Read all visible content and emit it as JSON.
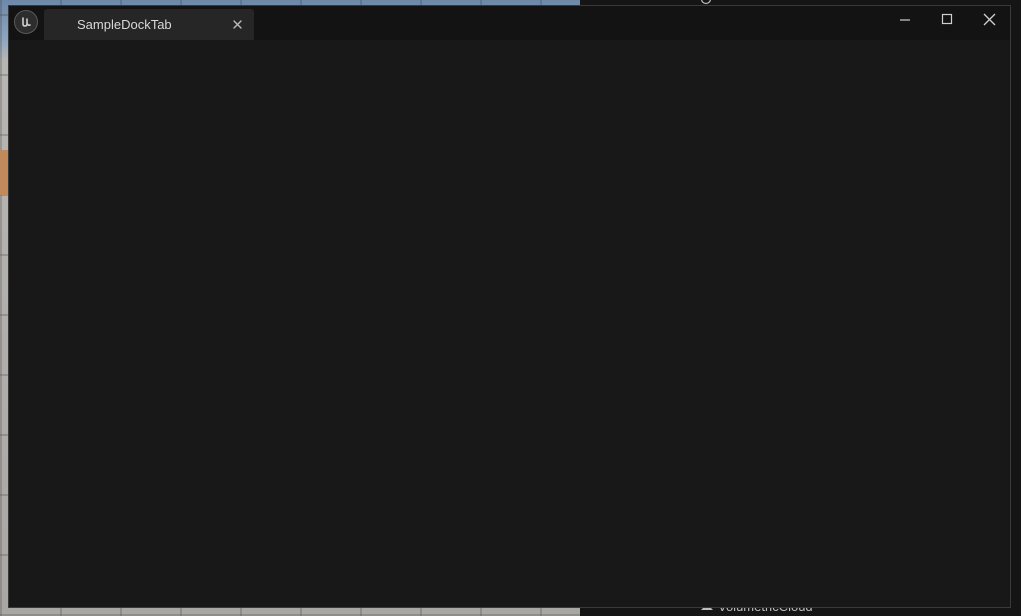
{
  "window": {
    "tab_label": "SampleDockTab"
  },
  "icons": {
    "app_logo": "unreal-engine-logo-icon",
    "tab_close": "close-icon",
    "minimize": "minimize-icon",
    "maximize": "maximize-icon",
    "close": "close-icon"
  },
  "background": {
    "outliner_bottom_label": "VolumetricCloud"
  },
  "colors": {
    "window_bg": "#181818",
    "titlebar_bg": "#131313",
    "tab_bg": "#262626",
    "text": "#d8d8d8"
  }
}
